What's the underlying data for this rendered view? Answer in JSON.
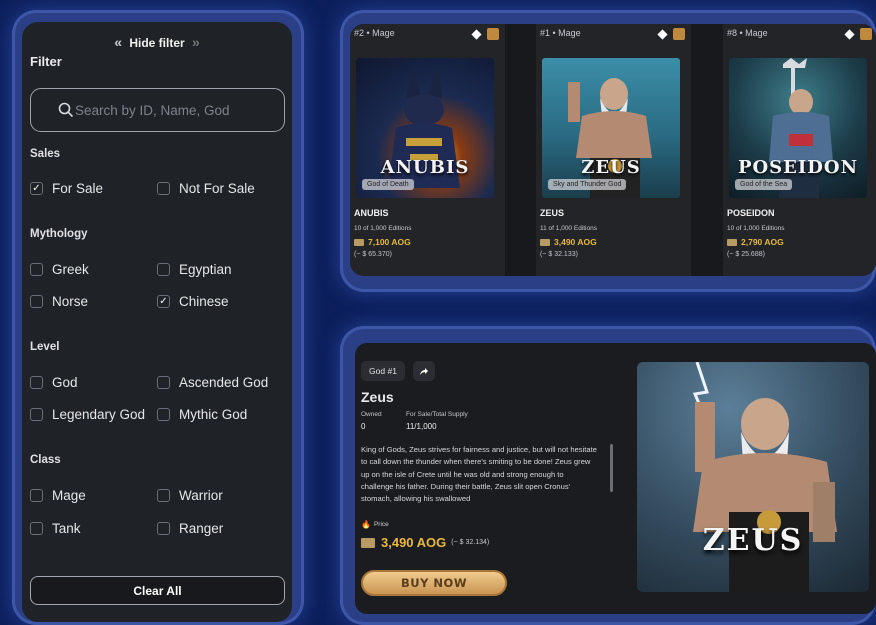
{
  "filter": {
    "hide_label": "Hide filter",
    "title": "Filter",
    "search_placeholder": "Search by ID, Name, God",
    "sections": {
      "sales": {
        "title": "Sales",
        "options": [
          {
            "label": "For Sale",
            "checked": true
          },
          {
            "label": "Not For Sale",
            "checked": false
          }
        ]
      },
      "mythology": {
        "title": "Mythology",
        "options": [
          {
            "label": "Greek",
            "checked": false
          },
          {
            "label": "Egyptian",
            "checked": false
          },
          {
            "label": "Norse",
            "checked": false
          },
          {
            "label": "Chinese",
            "checked": true
          }
        ]
      },
      "level": {
        "title": "Level",
        "options": [
          {
            "label": "God",
            "checked": false
          },
          {
            "label": "Ascended God",
            "checked": false
          },
          {
            "label": "Legendary God",
            "checked": false
          },
          {
            "label": "Mythic God",
            "checked": false
          }
        ]
      },
      "class": {
        "title": "Class",
        "options": [
          {
            "label": "Mage",
            "checked": false
          },
          {
            "label": "Warrior",
            "checked": false
          },
          {
            "label": "Tank",
            "checked": false
          },
          {
            "label": "Ranger",
            "checked": false
          }
        ]
      }
    },
    "clear_label": "Clear All",
    "check_mark": "✓"
  },
  "cards": [
    {
      "rank": "#2 • Mage",
      "name": "ANUBIS",
      "art_title": "ANUBIS",
      "tag": "God of Death",
      "editions": "10 of 1,000 Editions",
      "price": "7,100 AOG",
      "usd": "(~ $ 65.370)"
    },
    {
      "rank": "#1 • Mage",
      "name": "ZEUS",
      "art_title": "ZEUS",
      "tag": "Sky and Thunder God",
      "editions": "11 of 1,000 Editions",
      "price": "3,490 AOG",
      "usd": "(~ $ 32.133)"
    },
    {
      "rank": "#8 • Mage",
      "name": "POSEIDON",
      "art_title": "POSEIDON",
      "tag": "God of the Sea",
      "editions": "10 of 1,000 Editions",
      "price": "2,790 AOG",
      "usd": "(~ $ 25.688)"
    }
  ],
  "detail": {
    "god_tag": "God #1",
    "title": "Zeus",
    "owned_label": "Owned",
    "owned_value": "0",
    "supply_label": "For Sale/Total Supply",
    "supply_value": "11/1,000",
    "description": "King of Gods, Zeus strives for fairness and justice, but will not hesitate to call down the thunder when there's smiting to be done! Zeus grew up on the isle of Crete until he was old and strong enough to challenge his father. During their battle, Zeus slit open Cronus' stomach, allowing his swallowed",
    "price_label": "Price",
    "price": "3,490 AOG",
    "usd": "(~ $ 32.134)",
    "buy_label": "BUY NOW",
    "art_title": "ZEUS"
  },
  "colors": {
    "background": "#0c1f5c",
    "panel": "#1f2226",
    "gold": "#e8b93a",
    "frame": "#2a3f86"
  }
}
